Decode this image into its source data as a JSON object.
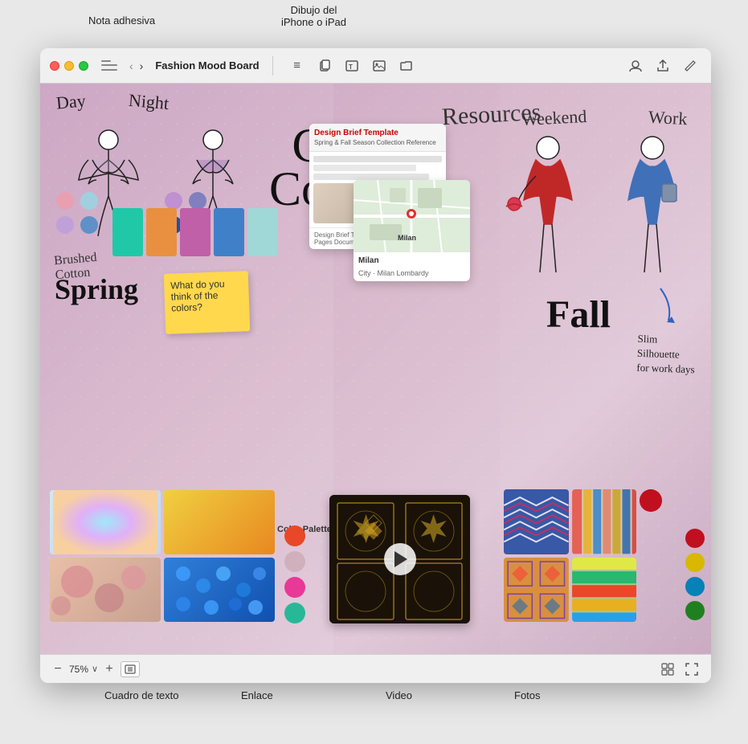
{
  "annotations": {
    "nota_adhesiva": "Nota adhesiva",
    "dibujo_iphone": "Dibujo del\niPhone o iPad",
    "cuadro_texto": "Cuadro de texto",
    "enlace": "Enlace",
    "video": "Video",
    "fotos": "Fotos"
  },
  "titlebar": {
    "title": "Fashion Mood Board",
    "back_arrow": "‹",
    "forward_arrow": "›",
    "sidebar_label": "sidebar toggle"
  },
  "toolbar": {
    "text_icon": "≡",
    "copy_icon": "⊡",
    "textbox_icon": "T",
    "image_icon": "⊞",
    "folder_icon": "⌂",
    "share_icon": "↑",
    "collab_icon": "👤",
    "edit_icon": "✏"
  },
  "canvas": {
    "capsule_line1": "Capsule",
    "capsule_line2": "Collection",
    "day_label": "Day",
    "night_label": "Night",
    "spring_label": "Spring",
    "brushed_cotton": "Brushed\nCotton",
    "resources_label": "Resources",
    "weekend_label": "Weekend",
    "work_label": "Work",
    "fall_label": "Fall",
    "slim_note": "Slim\nSilhouette\nfor work days",
    "sticky_note_text": "What do you think of the colors?",
    "color_palette_label": "Color\nPalette",
    "doc_title": "Design Brief Template",
    "doc_subtitle": "Spring & Fall Season Collection Reference",
    "doc_footer": "Design Brief Template\nPages Document · 1 MB",
    "milan_label": "Milan",
    "milan_sublabel": "City · Milan Lombardy"
  },
  "swatches_left": [
    {
      "color": "#e8a0b0",
      "row": 0
    },
    {
      "color": "#a0c8e8",
      "row": 0
    },
    {
      "color": "#d4b0d4",
      "row": 1
    },
    {
      "color": "#80b8d8",
      "row": 1
    }
  ],
  "fabric_colors": [
    "#20b8a0",
    "#e88040",
    "#c060a0",
    "#4090c0"
  ],
  "palette_colors": [
    "#e85030",
    "#d0b0c0",
    "#e840a0",
    "#30b0a0"
  ],
  "right_palette_colors": [
    "#c00020",
    "#e8c000",
    "#0090c0",
    "#208020"
  ],
  "bottom_images_left": [
    {
      "bg": "linear-gradient(135deg, #d0e8f0 0%, #b8d8f0 100%)"
    },
    {
      "bg": "linear-gradient(135deg, #e8d030 0%, #e8a030 100%)"
    },
    {
      "bg": "linear-gradient(135deg, #e8c0a8 0%, #d4a8c0 100%)"
    },
    {
      "bg": "linear-gradient(135deg, #4080d0 0%, #2060c0 100%)"
    }
  ],
  "statusbar": {
    "zoom_minus": "−",
    "zoom_value": "75%",
    "zoom_dropdown": "∨",
    "zoom_plus": "+",
    "fit_icon": "⊞"
  }
}
